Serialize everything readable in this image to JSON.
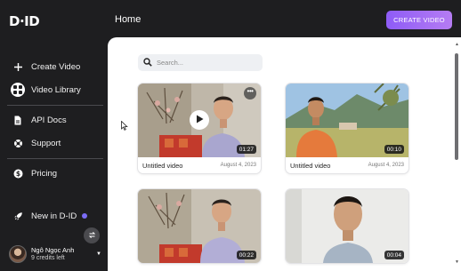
{
  "header": {
    "logo_text": "D·ID",
    "page_title": "Home",
    "create_button": "CREATE VIDEO"
  },
  "sidebar": {
    "items": [
      {
        "label": "Create Video",
        "icon": "plus-icon"
      },
      {
        "label": "Video Library",
        "icon": "grid-icon"
      },
      {
        "label": "API Docs",
        "icon": "document-icon"
      },
      {
        "label": "Support",
        "icon": "lifebuoy-icon"
      },
      {
        "label": "Pricing",
        "icon": "dollar-icon"
      },
      {
        "label": "New in D-ID",
        "icon": "rocket-icon"
      }
    ],
    "user": {
      "name": "Ngô Ngọc Anh",
      "credits": "9 credits left"
    }
  },
  "search": {
    "placeholder": "Search..."
  },
  "videos": [
    {
      "title": "Untitled video",
      "date": "August 4, 2023",
      "duration": "01:27"
    },
    {
      "title": "Untitled video",
      "date": "August 4, 2023",
      "duration": "00:10"
    },
    {
      "title": "",
      "date": "",
      "duration": "00:22"
    },
    {
      "title": "",
      "date": "",
      "duration": "00:04"
    }
  ],
  "colors": {
    "accent_start": "#8e5cf6",
    "accent_end": "#b57cf3",
    "sidebar_bg": "#1e1e20"
  }
}
